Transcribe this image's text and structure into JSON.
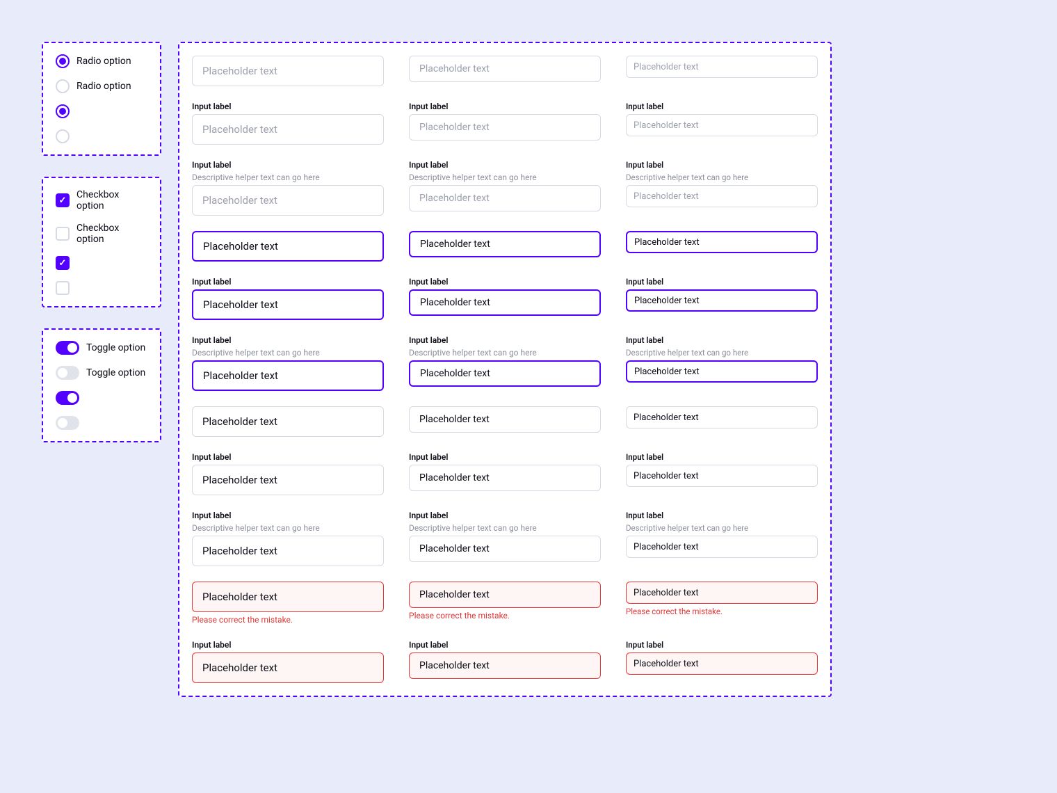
{
  "colors": {
    "accent": "#5200FF",
    "error": "#E53535",
    "page_bg": "#E8ECFA"
  },
  "sidebar": {
    "radio": {
      "options": [
        {
          "label": "Radio option",
          "selected": true,
          "has_label": true
        },
        {
          "label": "Radio option",
          "selected": false,
          "has_label": true
        },
        {
          "label": "",
          "selected": true,
          "has_label": false
        },
        {
          "label": "",
          "selected": false,
          "has_label": false
        }
      ]
    },
    "checkbox": {
      "options": [
        {
          "label": "Checkbox option",
          "checked": true,
          "has_label": true
        },
        {
          "label": "Checkbox option",
          "checked": false,
          "has_label": true
        },
        {
          "label": "",
          "checked": true,
          "has_label": false
        },
        {
          "label": "",
          "checked": false,
          "has_label": false
        }
      ]
    },
    "toggle": {
      "options": [
        {
          "label": "Toggle option",
          "on": true,
          "has_label": true
        },
        {
          "label": "Toggle option",
          "on": false,
          "has_label": true
        },
        {
          "label": "",
          "on": true,
          "has_label": false
        },
        {
          "label": "",
          "on": false,
          "has_label": false
        }
      ]
    }
  },
  "strings": {
    "input_label": "Input label",
    "placeholder": "Placeholder text",
    "helper": "Descriptive helper text can go here",
    "error": "Please correct the mistake."
  },
  "input_rows": [
    {
      "state": "default",
      "placeholder": true,
      "label": false,
      "helper": false
    },
    {
      "state": "default",
      "placeholder": true,
      "label": true,
      "helper": false
    },
    {
      "state": "default",
      "placeholder": true,
      "label": true,
      "helper": true
    },
    {
      "state": "focus",
      "placeholder": false,
      "label": false,
      "helper": false
    },
    {
      "state": "focus",
      "placeholder": false,
      "label": true,
      "helper": false
    },
    {
      "state": "focus",
      "placeholder": false,
      "label": true,
      "helper": true
    },
    {
      "state": "filled",
      "placeholder": false,
      "label": false,
      "helper": false
    },
    {
      "state": "filled",
      "placeholder": false,
      "label": true,
      "helper": false
    },
    {
      "state": "filled",
      "placeholder": false,
      "label": true,
      "helper": true
    },
    {
      "state": "error",
      "placeholder": false,
      "label": false,
      "helper": false,
      "error_helper": true
    },
    {
      "state": "error",
      "placeholder": false,
      "label": true,
      "helper": false
    }
  ],
  "sizes": [
    "lg",
    "md",
    "sm"
  ]
}
